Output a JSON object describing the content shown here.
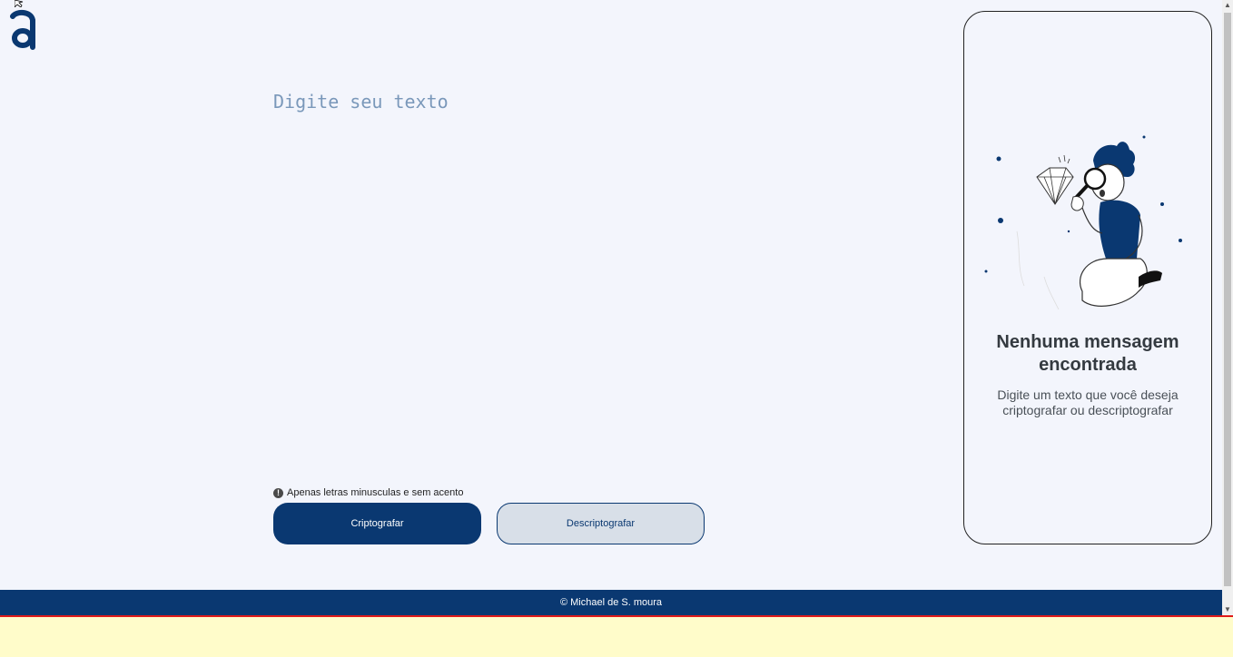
{
  "input": {
    "placeholder": "Digite seu texto",
    "value": ""
  },
  "hint": {
    "text": "Apenas letras minusculas e sem acento"
  },
  "buttons": {
    "encrypt": "Criptografar",
    "decrypt": "Descriptografar"
  },
  "panel": {
    "title": "Nenhuma mensagem encontrada",
    "text": "Digite um texto que você deseja criptografar ou descriptografar"
  },
  "footer": {
    "text": "© Michael de S. moura"
  },
  "colors": {
    "primary": "#0A3871",
    "background": "#F3F5FC",
    "secondary_bg": "#D8DFE8",
    "bottom_bar": "#FFFCCA"
  },
  "icons": [
    "logo-icon",
    "info-icon",
    "detective-illustration",
    "cursor-icon"
  ]
}
